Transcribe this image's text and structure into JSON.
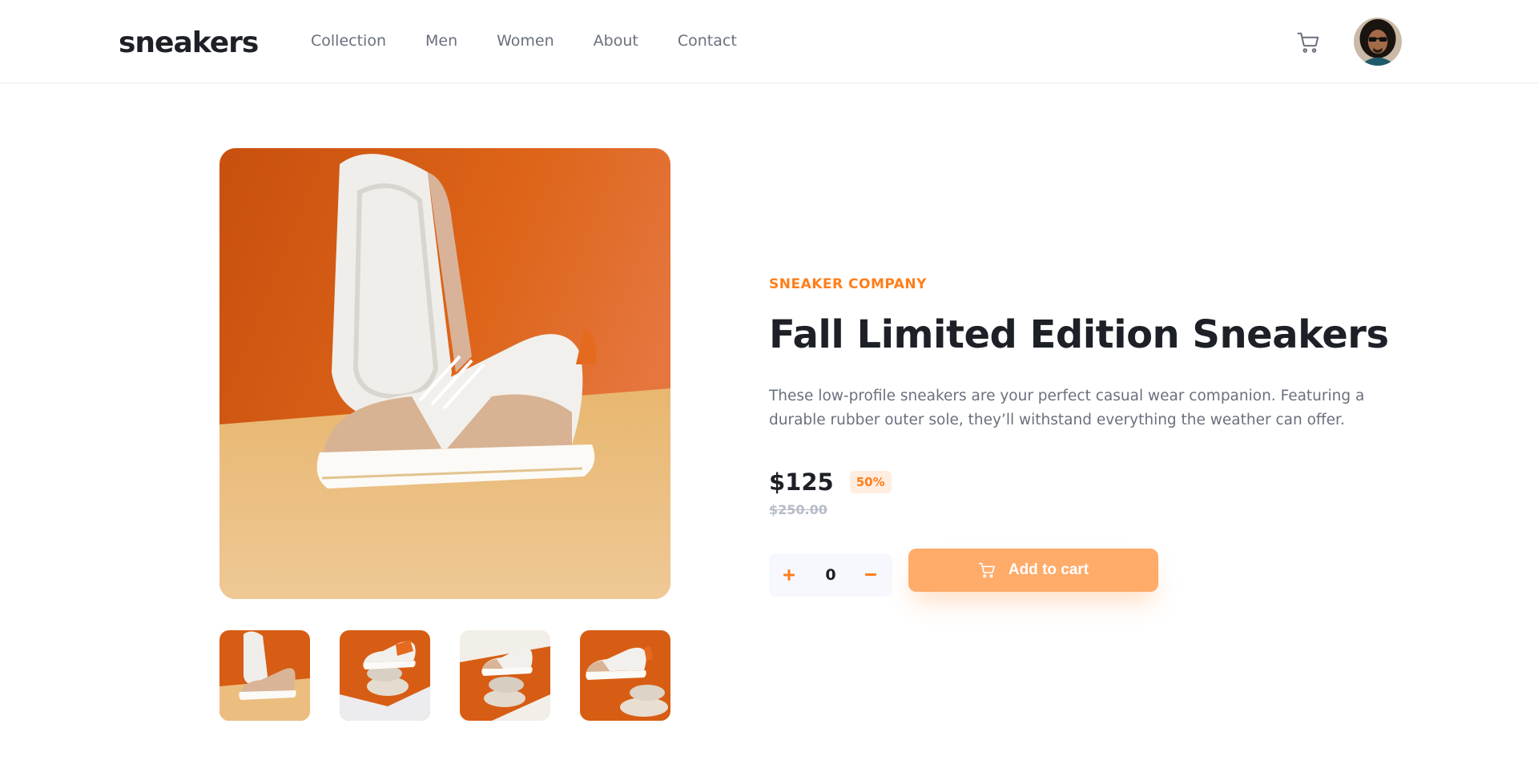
{
  "brand": {
    "logo_text": "sneakers"
  },
  "nav": {
    "items": [
      {
        "label": "Collection"
      },
      {
        "label": "Men"
      },
      {
        "label": "Women"
      },
      {
        "label": "About"
      },
      {
        "label": "Contact"
      }
    ]
  },
  "header": {
    "cart_icon": "cart-icon",
    "avatar": "user-avatar"
  },
  "gallery": {
    "main_image": "product-image-1",
    "thumbnails": [
      "product-thumbnail-1",
      "product-thumbnail-2",
      "product-thumbnail-3",
      "product-thumbnail-4"
    ]
  },
  "product": {
    "company": "SNEAKER COMPANY",
    "title": "Fall Limited Edition Sneakers",
    "description": "These low-profile sneakers are your perfect casual wear companion. Featuring a durable rubber outer sole, they’ll withstand everything the weather can offer.",
    "price": "$125",
    "discount": "50%",
    "original_price": "$250.00"
  },
  "cart_controls": {
    "quantity": "0",
    "plus_icon": "plus-icon",
    "minus_icon": "minus-icon",
    "add_to_cart_label": "Add to cart"
  },
  "colors": {
    "accent": "#ff7e1b",
    "accent_light": "#ffab6a",
    "discount_bg": "#ffede0",
    "text_dark": "#1d2026",
    "text_gray": "#69707d",
    "text_muted": "#b6bcc8",
    "qty_bg": "#f6f8fd"
  }
}
